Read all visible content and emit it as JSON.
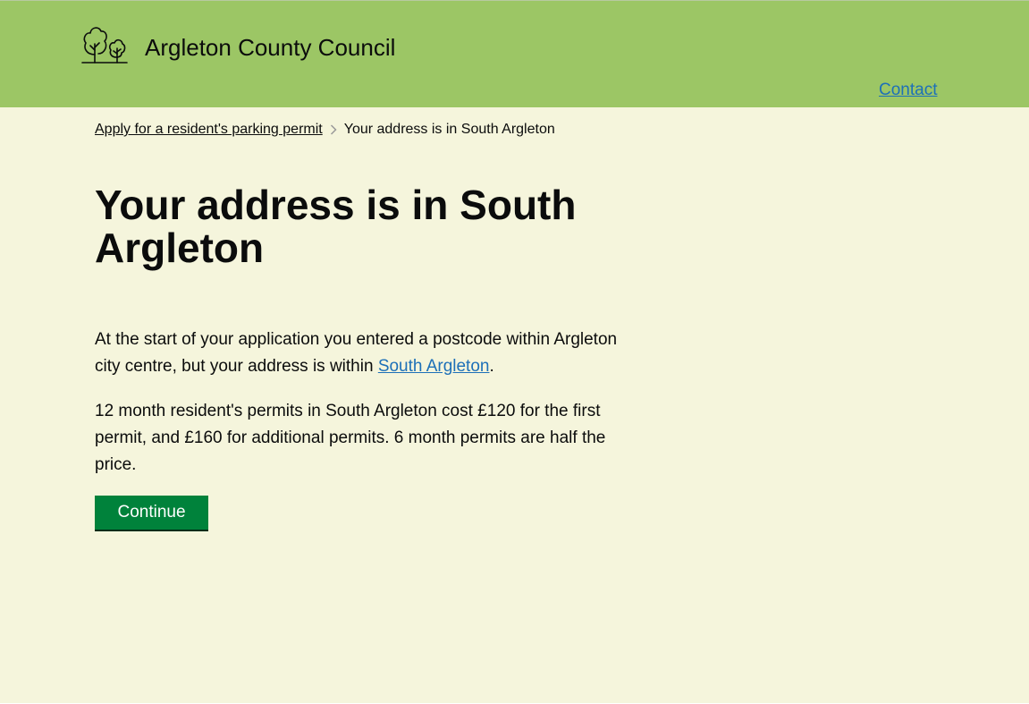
{
  "header": {
    "brand_name": "Argleton County Council",
    "logo_icon": "trees-icon",
    "contact_label": "Contact"
  },
  "breadcrumb": {
    "parent_label": "Apply for a resident's parking permit",
    "current_label": "Your address is in South Argleton"
  },
  "main": {
    "title": "Your address is in South Argleton",
    "para1_before_link": "At the start of your application you entered a postcode within Argleton city centre, but your address is within ",
    "para1_link": "South Argleton",
    "para1_after_link": ".",
    "para2": "12 month resident's permits in South Argleton cost £120 for the first permit, and £160 for additional permits. 6 month permits are half the price.",
    "continue_label": "Continue"
  },
  "colors": {
    "header_bg": "#9cc665",
    "page_bg": "#f5f5dc",
    "link": "#1d70b8",
    "button_bg": "#00823b",
    "text": "#0b0c0c"
  }
}
